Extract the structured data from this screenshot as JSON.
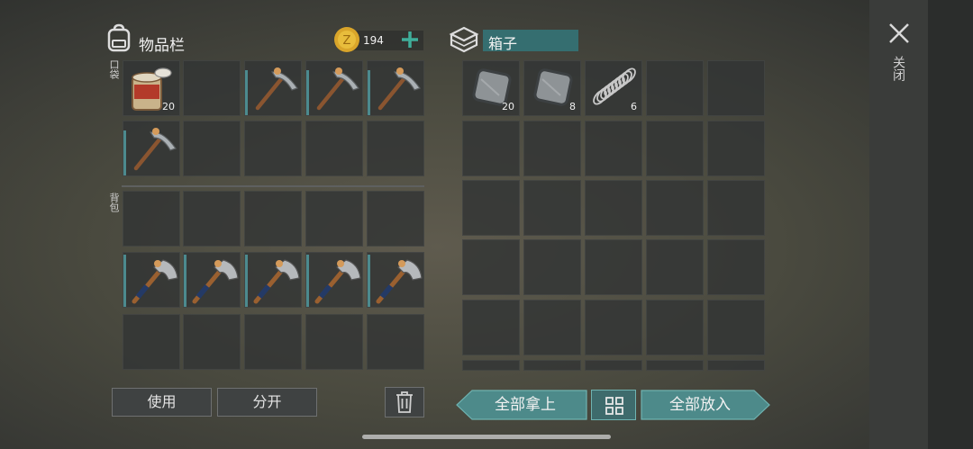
{
  "inventory": {
    "title": "物品栏",
    "coins": "194",
    "pocket_label": "口袋",
    "backpack_label": "背包",
    "pocket_slots": [
      {
        "item": "tin-can-icon",
        "qty": "20",
        "bar": false
      },
      {
        "item": "",
        "qty": "",
        "bar": false
      },
      {
        "item": "pickaxe-icon",
        "qty": "",
        "bar": true
      },
      {
        "item": "pickaxe-icon",
        "qty": "",
        "bar": true
      },
      {
        "item": "pickaxe-icon",
        "qty": "",
        "bar": true
      },
      {
        "item": "pickaxe-icon",
        "qty": "",
        "bar": true
      },
      {
        "item": "",
        "qty": "",
        "bar": false
      },
      {
        "item": "",
        "qty": "",
        "bar": false
      },
      {
        "item": "",
        "qty": "",
        "bar": false
      },
      {
        "item": "",
        "qty": "",
        "bar": false
      }
    ],
    "backpack_slots": [
      {
        "item": "",
        "qty": "",
        "bar": false
      },
      {
        "item": "",
        "qty": "",
        "bar": false
      },
      {
        "item": "",
        "qty": "",
        "bar": false
      },
      {
        "item": "",
        "qty": "",
        "bar": false
      },
      {
        "item": "",
        "qty": "",
        "bar": false
      },
      {
        "item": "axe-icon",
        "qty": "",
        "bar": true
      },
      {
        "item": "axe-icon",
        "qty": "",
        "bar": true
      },
      {
        "item": "axe-icon",
        "qty": "",
        "bar": true
      },
      {
        "item": "axe-icon",
        "qty": "",
        "bar": true
      },
      {
        "item": "axe-icon",
        "qty": "",
        "bar": true
      },
      {
        "item": "",
        "qty": "",
        "bar": false
      },
      {
        "item": "",
        "qty": "",
        "bar": false
      },
      {
        "item": "",
        "qty": "",
        "bar": false
      },
      {
        "item": "",
        "qty": "",
        "bar": false
      },
      {
        "item": "",
        "qty": "",
        "bar": false
      }
    ],
    "use_label": "使用",
    "split_label": "分开"
  },
  "box": {
    "name": "箱子",
    "slots": [
      {
        "item": "iron-plate-icon",
        "qty": "20"
      },
      {
        "item": "iron-plate-icon",
        "qty": "8"
      },
      {
        "item": "spring-icon",
        "qty": "6"
      }
    ],
    "take_all_label": "全部拿上",
    "put_all_label": "全部放入"
  },
  "close_label": "关闭",
  "colors": {
    "accent": "#4c8a8e",
    "coin": "#d9a52a",
    "plus": "#3fae9a"
  }
}
